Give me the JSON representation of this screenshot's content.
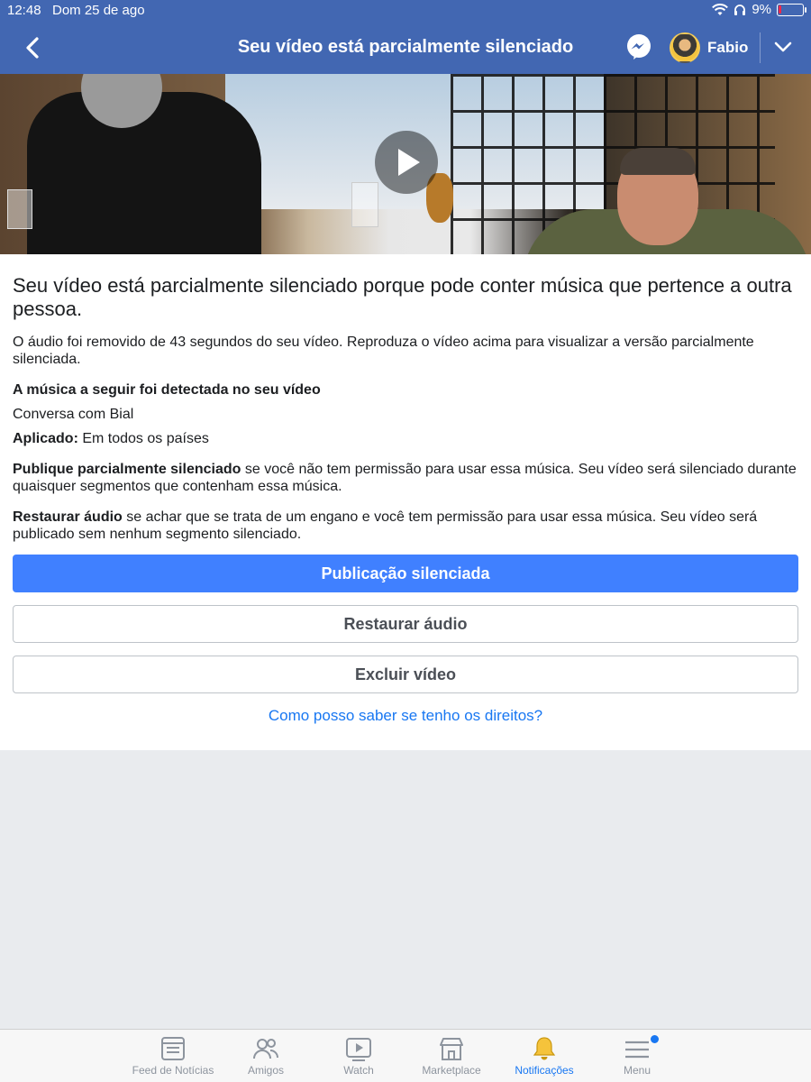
{
  "status_bar": {
    "time": "12:48",
    "date": "Dom 25 de ago",
    "battery": "9%"
  },
  "nav": {
    "title": "Seu vídeo está parcialmente silenciado",
    "user_name": "Fabio",
    "icons": [
      "back-chevron-icon",
      "messenger-icon",
      "chevron-down-icon"
    ]
  },
  "content": {
    "headline": "Seu vídeo está parcialmente silenciado porque pode conter música que pertence a outra pessoa.",
    "removed_text": "O áudio foi removido de 43 segundos do seu vídeo. Reproduza o vídeo acima para visualizar a versão parcialmente silenciada.",
    "detected_heading": "A música a seguir foi detectada no seu vídeo",
    "song": "Conversa com Bial",
    "applied_label": "Aplicado:",
    "applied_value": "Em todos os países",
    "publish_bold": "Publique parcialmente silenciado",
    "publish_rest": "se você não tem permissão para usar essa música. Seu vídeo será silenciado durante quaisquer segmentos que contenham essa música.",
    "restore_bold": "Restaurar áudio",
    "restore_rest": "se achar que se trata de um engano e você tem permissão para usar essa música. Seu vídeo será publicado sem nenhum segmento silenciado."
  },
  "buttons": {
    "publish": "Publicação silenciada",
    "restore": "Restaurar áudio",
    "delete": "Excluir vídeo"
  },
  "help_link": "Como posso saber se tenho os direitos?",
  "tabbar": {
    "feed": "Feed de Notícias",
    "friends": "Amigos",
    "watch": "Watch",
    "marketplace": "Marketplace",
    "notifications": "Notificações",
    "menu": "Menu",
    "active": "Notificações"
  },
  "colors": {
    "header": "#4267b2",
    "primary_button": "#4080ff",
    "link": "#1877f2"
  }
}
